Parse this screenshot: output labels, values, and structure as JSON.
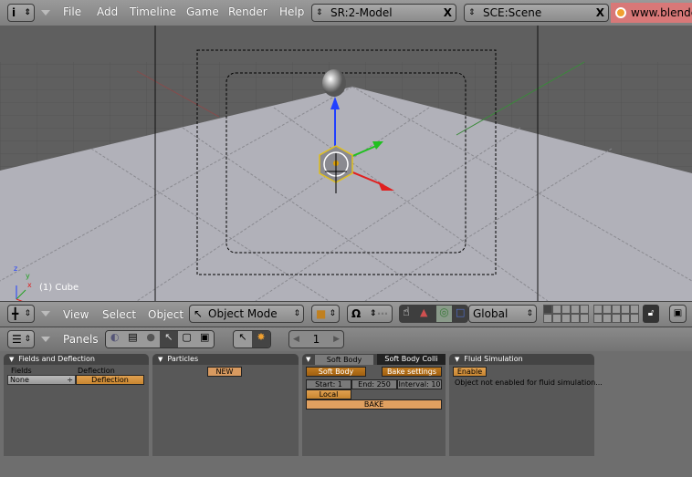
{
  "top_header": {
    "menus": [
      "File",
      "Add",
      "Timeline",
      "Game",
      "Render",
      "Help"
    ],
    "screen": "SR:2-Model",
    "scene": "SCE:Scene",
    "url": "www.blender.org",
    "close": "X"
  },
  "viewport": {
    "object_label": "(1) Cube",
    "axes": [
      "z",
      "y",
      "x"
    ]
  },
  "view3d_header": {
    "menus": [
      "View",
      "Select",
      "Object"
    ],
    "mode": "Object Mode",
    "orientation": "Global"
  },
  "buttons_header": {
    "panels_label": "Panels",
    "page": "1"
  },
  "panels": {
    "fields": {
      "title": "Fields and Deflection",
      "fields_label": "Fields",
      "fields_value": "None",
      "deflection_label": "Deflection",
      "deflection_button": "Deflection"
    },
    "particles": {
      "title": "Particles",
      "new_button": "NEW"
    },
    "softbody": {
      "tab_active": "Soft Body",
      "tab_other": "Soft Body Colli",
      "softbody_button": "Soft Body",
      "bake_settings": "Bake settings",
      "start": "Start: 1",
      "end": "End: 250",
      "interval": "Interval: 10",
      "local": "Local",
      "bake": "BAKE"
    },
    "fluid": {
      "title": "Fluid Simulation",
      "enable": "Enable",
      "message": "Object not enabled for fluid simulation..."
    }
  },
  "colors": {
    "accent": "#d89a48",
    "url_bg": "#d87878"
  }
}
